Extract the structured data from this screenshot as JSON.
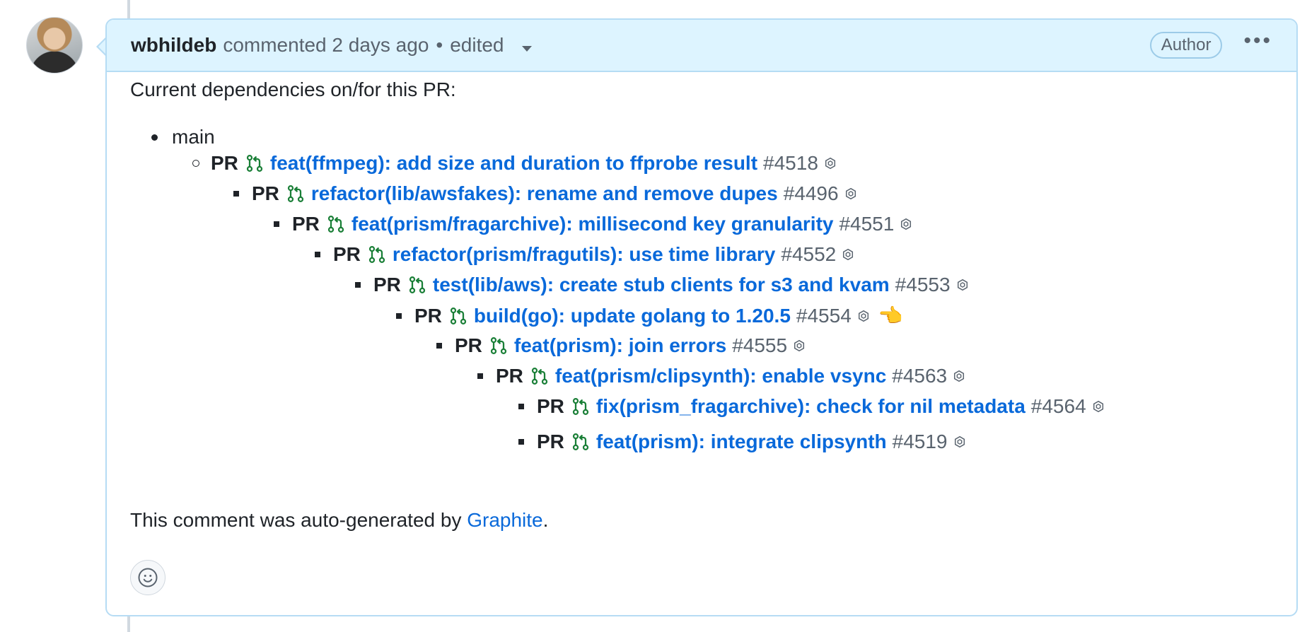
{
  "comment": {
    "author": "wbhildeb",
    "action_text": "commented 2 days ago",
    "separator": "•",
    "edited_label": "edited",
    "author_badge": "Author",
    "menu_icon": "kebab-horizontal-icon"
  },
  "body": {
    "intro": "Current dependencies on/for this PR:",
    "root_branch": "main",
    "pr_prefix": "PR",
    "prs": [
      {
        "title": "feat(ffmpeg): add size and duration to ffprobe result",
        "number": "#4518"
      },
      {
        "title": "refactor(lib/awsfakes): rename and remove dupes",
        "number": "#4496"
      },
      {
        "title": "feat(prism/fragarchive): millisecond key granularity",
        "number": "#4551"
      },
      {
        "title": "refactor(prism/fragutils): use time library",
        "number": "#4552"
      },
      {
        "title": "test(lib/aws): create stub clients for s3 and kvam",
        "number": "#4553"
      },
      {
        "title": "build(go): update golang to 1.20.5",
        "number": "#4554",
        "current": "👈"
      },
      {
        "title": "feat(prism): join errors",
        "number": "#4555"
      },
      {
        "title": "feat(prism/clipsynth): enable vsync",
        "number": "#4563"
      },
      {
        "title": "fix(prism_fragarchive): check for nil metadata",
        "number": "#4564"
      },
      {
        "title": "feat(prism): integrate clipsynth",
        "number": "#4519"
      }
    ],
    "footer_prefix": "This comment was auto-generated by ",
    "footer_link": "Graphite",
    "footer_suffix": "."
  },
  "colors": {
    "link": "#0969da",
    "pr_open_icon": "#1a7f37",
    "header_bg": "#ddf4ff",
    "border": "#b6dcf4"
  }
}
